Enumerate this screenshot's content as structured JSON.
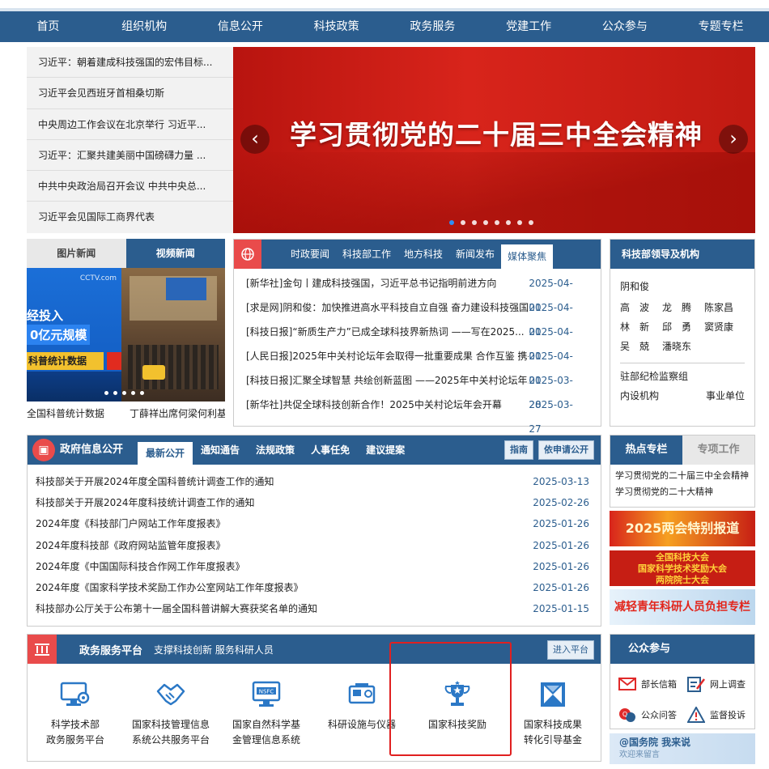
{
  "nav": [
    "首页",
    "组织机构",
    "信息公开",
    "科技政策",
    "政务服务",
    "党建工作",
    "公众参与",
    "专题专栏"
  ],
  "headlines": [
    "习近平：朝着建成科技强国的宏伟目标...",
    "习近平会见西班牙首相桑切斯",
    "中央周边工作会议在北京举行 习近平...",
    "习近平：汇聚共建美丽中国磅礴力量 ...",
    "中共中央政治局召开会议 中共中央总...",
    "习近平会见国际工商界代表"
  ],
  "banner": {
    "title": "学习贯彻党的二十届三中全会精神",
    "prev": "‹",
    "next": "›"
  },
  "pic_news": {
    "tabs": [
      "图片新闻",
      "视频新闻"
    ],
    "img1_lines": [
      "经投入",
      "0亿元规模",
      "科普统计数据"
    ],
    "img1_logo": "CCTV.com",
    "captions": [
      "全国科普统计数据",
      "丁薛祥出席何梁何利基"
    ]
  },
  "news": {
    "tabs": [
      "时政要闻",
      "科技部工作",
      "地方科技",
      "新闻发布",
      "媒体聚焦"
    ],
    "items": [
      {
        "t": "[新华社]金句丨建成科技强国，习近平总书记指明前进方向",
        "d": "2025-04-01"
      },
      {
        "t": "[求是网]阴和俊：加快推进高水平科技自立自强 奋力建设科技强国",
        "d": "2025-04-01"
      },
      {
        "t": "[科技日报]“新质生产力”已成全球科技界新热词 ——写在2025...",
        "d": "2025-04-01"
      },
      {
        "t": "[人民日报]2025年中关村论坛年会取得一批重要成果 合作互鉴 携手...",
        "d": "2025-04-01"
      },
      {
        "t": "[科技日报]汇聚全球智慧 共绘创新蓝图 ——2025年中关村论坛年...",
        "d": "2025-03-28"
      },
      {
        "t": "[新华社]共促全球科技创新合作！2025中关村论坛年会开幕",
        "d": "2025-03-27"
      }
    ]
  },
  "leaders": {
    "title": "科技部领导及机构",
    "first": "阴和俊",
    "rows": [
      [
        "高　波",
        "龙　腾",
        "陈家昌"
      ],
      [
        "林　新",
        "邱　勇",
        "窦贤康"
      ],
      [
        "吴　兢",
        "潘晓东"
      ]
    ],
    "org1": "驻部纪检监察组",
    "org2": [
      "内设机构",
      "事业单位"
    ]
  },
  "gov_info": {
    "title": "政府信息公开",
    "tabs": [
      "最新公开",
      "通知通告",
      "法规政策",
      "人事任免",
      "建议提案"
    ],
    "buttons": [
      "指南",
      "依申请公开"
    ],
    "items": [
      {
        "t": "科技部关于开展2024年度全国科普统计调查工作的通知",
        "d": "2025-03-13"
      },
      {
        "t": "科技部关于开展2024年度科技统计调查工作的通知",
        "d": "2025-02-26"
      },
      {
        "t": "2024年度《科技部门户网站工作年度报表》",
        "d": "2025-01-26"
      },
      {
        "t": "2024年度科技部《政府网站监管年度报表》",
        "d": "2025-01-26"
      },
      {
        "t": "2024年度《中国国际科技合作网工作年度报表》",
        "d": "2025-01-26"
      },
      {
        "t": "2024年度《国家科学技术奖励工作办公室网站工作年度报表》",
        "d": "2025-01-26"
      },
      {
        "t": "科技部办公厅关于公布第十一届全国科普讲解大赛获奖名单的通知",
        "d": "2025-01-15"
      }
    ]
  },
  "hot": {
    "tabs": [
      "热点专栏",
      "专项工作"
    ],
    "items": [
      "学习贯彻党的二十届三中全会精神",
      "学习贯彻党的二十大精神"
    ],
    "banners": [
      "2025两会特别报道",
      "全国科技大会",
      "国家科学技术奖励大会",
      "两院院士大会",
      "减轻青年科研人员负担专栏"
    ]
  },
  "gov_service": {
    "title": "政务服务平台",
    "subtitle": "支撑科技创新 服务科研人员",
    "enter": "进入平台",
    "items": [
      {
        "l1": "科学技术部",
        "l2": "政务服务平台",
        "icon": "monitor-gear-icon"
      },
      {
        "l1": "国家科技管理信息",
        "l2": "系统公共服务平台",
        "icon": "handshake-icon"
      },
      {
        "l1": "国家自然科学基",
        "l2": "金管理信息系统",
        "icon": "nsfc-screen-icon"
      },
      {
        "l1": "科研设施与仪器",
        "l2": "",
        "icon": "instrument-icon"
      },
      {
        "l1": "国家科技奖励",
        "l2": "",
        "icon": "trophy-icon"
      },
      {
        "l1": "国家科技成果",
        "l2": "转化引导基金",
        "icon": "fund-icon"
      }
    ],
    "nsfc_label": "NSFC"
  },
  "public": {
    "title": "公众参与",
    "items": [
      {
        "label": "部长信箱",
        "icon": "mail-icon"
      },
      {
        "label": "网上调查",
        "icon": "survey-icon"
      },
      {
        "label": "公众问答",
        "icon": "qa-icon"
      },
      {
        "label": "监督投诉",
        "icon": "warning-icon"
      }
    ],
    "gwy_line1": "@国务院 我来说",
    "gwy_line2": "欢迎来留言"
  },
  "colors": {
    "primary": "#2b5d8e",
    "accent_red": "#e94b4b",
    "date_blue": "#2b5d8e"
  }
}
